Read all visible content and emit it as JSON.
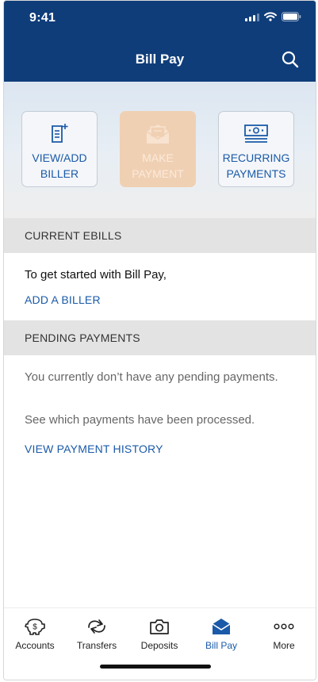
{
  "status": {
    "time": "9:41"
  },
  "header": {
    "title": "Bill Pay",
    "search_icon": "search-icon"
  },
  "actions": [
    {
      "line1": "VIEW/ADD",
      "line2": "BILLER",
      "icon": "document-add-icon",
      "disabled": false
    },
    {
      "line1": "MAKE",
      "line2": "PAYMENT",
      "icon": "envelope-open-icon",
      "disabled": true
    },
    {
      "line1": "RECURRING",
      "line2": "PAYMENTS",
      "icon": "currency-note-icon",
      "disabled": false
    }
  ],
  "ebills": {
    "header": "CURRENT EBILLS",
    "intro": "To get started with Bill Pay,",
    "link": "ADD A BILLER"
  },
  "pending": {
    "header": "PENDING PAYMENTS",
    "empty_text": "You currently don’t have any pending payments.",
    "history_text": "See which payments have been processed.",
    "history_link": "VIEW PAYMENT HISTORY"
  },
  "tabs": [
    {
      "label": "Accounts",
      "icon": "piggy-bank-dollar-icon",
      "active": false
    },
    {
      "label": "Transfers",
      "icon": "transfer-arrows-icon",
      "active": false
    },
    {
      "label": "Deposits",
      "icon": "camera-icon",
      "active": false
    },
    {
      "label": "Bill Pay",
      "icon": "envelope-open-icon",
      "active": true
    },
    {
      "label": "More",
      "icon": "more-dots-icon",
      "active": false
    }
  ],
  "colors": {
    "header": "#0f3d7a",
    "accent": "#1a5aa8",
    "disabled_tile": "#f0d0b3"
  }
}
